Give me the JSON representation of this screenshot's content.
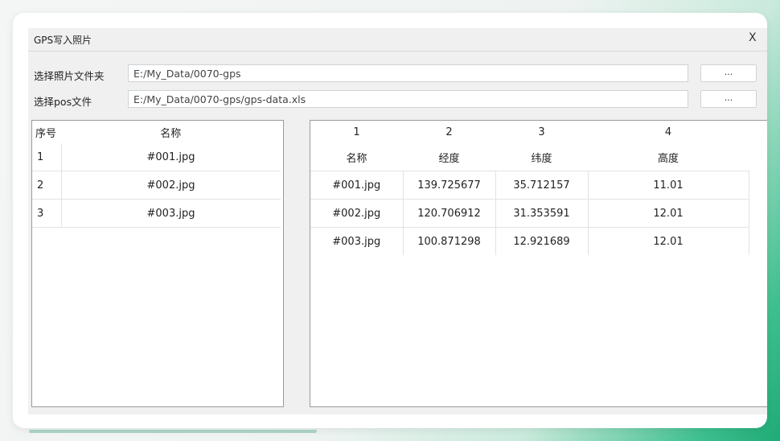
{
  "window": {
    "title": "GPS写入照片",
    "close_glyph": "X"
  },
  "photo_folder": {
    "label": "选择照片文件夹",
    "value": "E:/My_Data/0070-gps",
    "browse_label": "..."
  },
  "pos_file": {
    "label": "选择pos文件",
    "value": "E:/My_Data/0070-gps/gps-data.xls",
    "browse_label": "..."
  },
  "photo_table": {
    "headers": [
      "序号",
      "名称"
    ],
    "rows": [
      {
        "index": "1",
        "name": "#001.jpg"
      },
      {
        "index": "2",
        "name": "#002.jpg"
      },
      {
        "index": "3",
        "name": "#003.jpg"
      }
    ]
  },
  "pos_table": {
    "column_numbers": [
      "1",
      "2",
      "3",
      "4"
    ],
    "headers": [
      "名称",
      "经度",
      "纬度",
      "高度"
    ],
    "rows": [
      {
        "name": "#001.jpg",
        "lon": "139.725677",
        "lat": "35.712157",
        "alt": "11.01"
      },
      {
        "name": "#002.jpg",
        "lon": "120.706912",
        "lat": "31.353591",
        "alt": "12.01"
      },
      {
        "name": "#003.jpg",
        "lon": "100.871298",
        "lat": "12.921689",
        "alt": "12.01"
      }
    ]
  }
}
